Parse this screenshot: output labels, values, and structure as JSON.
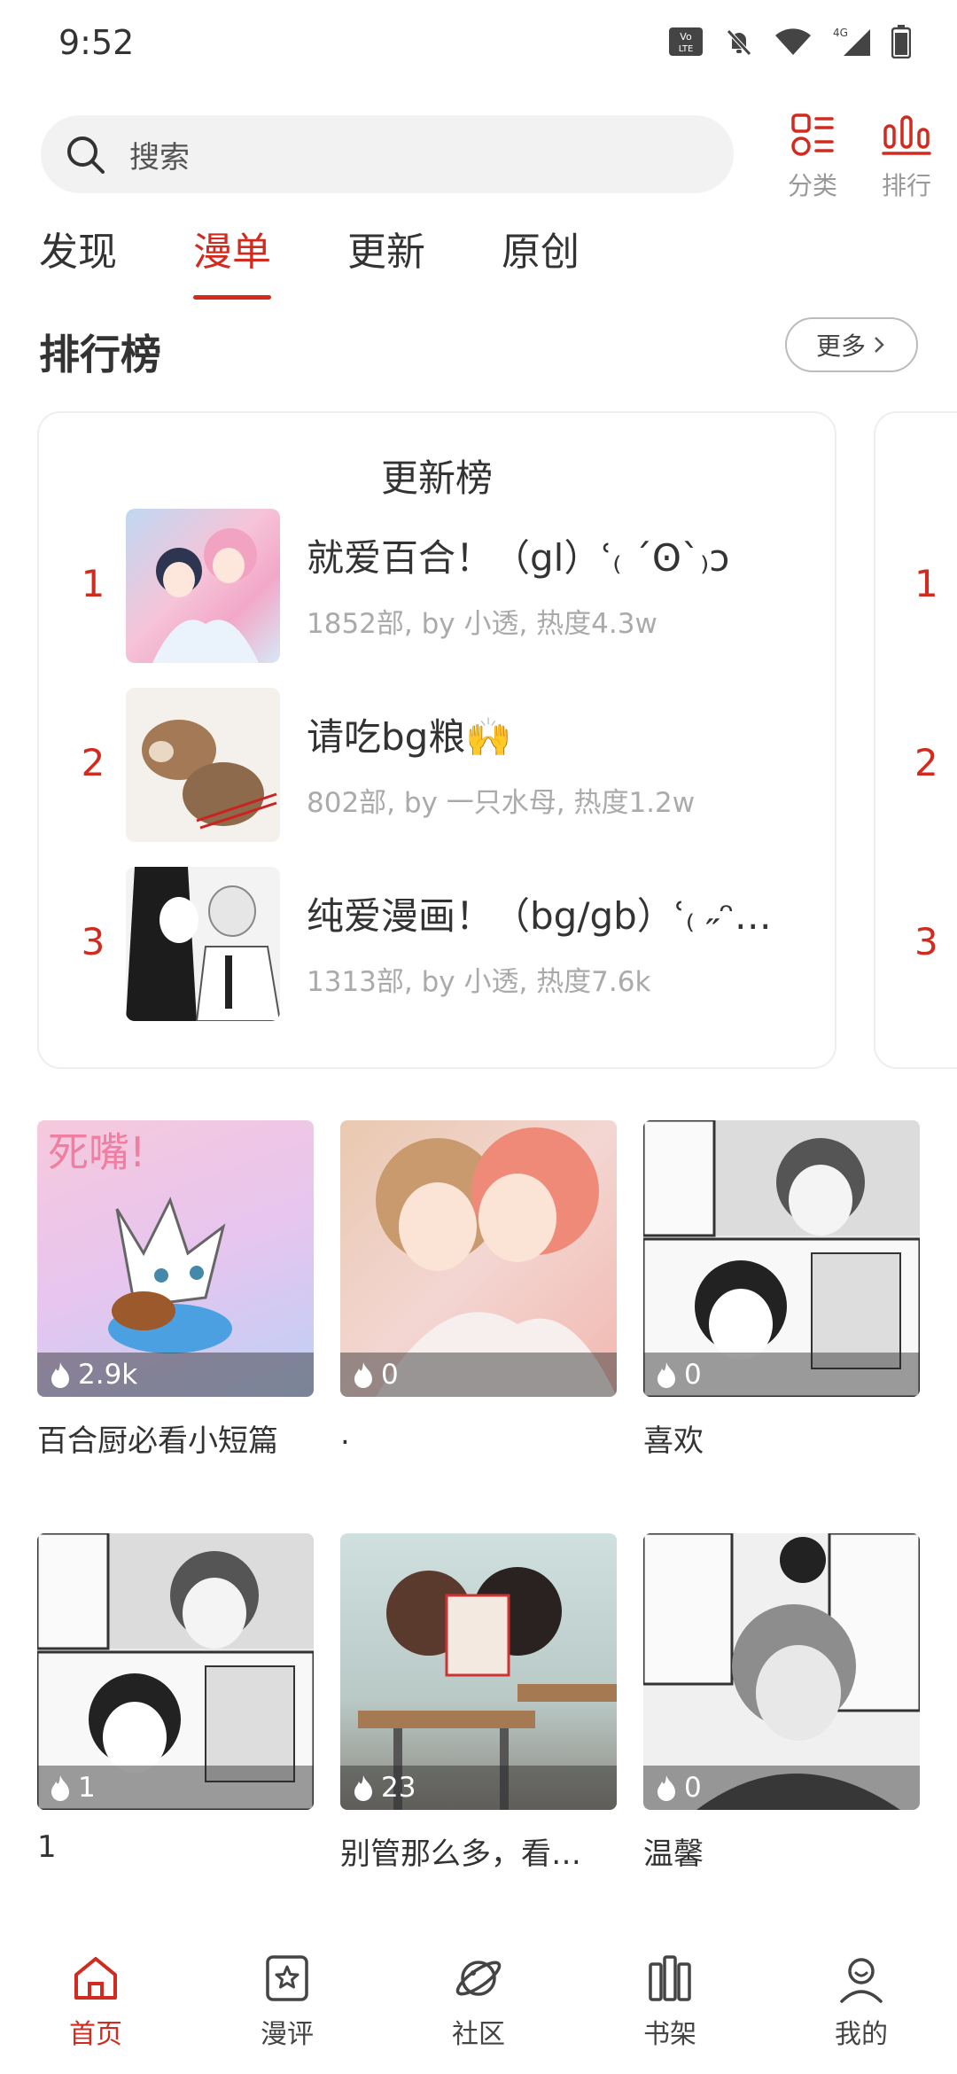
{
  "status_bar": {
    "time": "9:52",
    "network": "4G"
  },
  "search": {
    "placeholder": "搜索"
  },
  "top_actions": {
    "category_label": "分类",
    "ranking_label": "排行"
  },
  "tabs": [
    {
      "label": "发现",
      "active": false
    },
    {
      "label": "漫单",
      "active": true
    },
    {
      "label": "更新",
      "active": false
    },
    {
      "label": "原创",
      "active": false
    }
  ],
  "ranking_section": {
    "title": "排行榜",
    "more_label": "更多",
    "card_title": "更新榜",
    "items": [
      {
        "rank": "1",
        "name": "就爱百合！（gl）ʿ₍ ´Ꙩ`₎ᴐ",
        "meta": "1852部, by 小透, 热度4.3w"
      },
      {
        "rank": "2",
        "name": "请吃bg粮🙌",
        "meta": "802部, by 一只水母, 热度1.2w"
      },
      {
        "rank": "3",
        "name": "纯爱漫画！（bg/gb）ʿ₍ ˶ᵔ…",
        "meta": "1313部, by 小透, 热度7.6k"
      }
    ],
    "peek_ranks": [
      "1",
      "2",
      "3"
    ]
  },
  "lists": [
    {
      "title": "百合厨必看小短篇",
      "heat": "2.9k"
    },
    {
      "title": ".",
      "heat": "0"
    },
    {
      "title": "喜欢",
      "heat": "0"
    },
    {
      "title": "1",
      "heat": "1"
    },
    {
      "title": "别管那么多，看…",
      "heat": "23"
    },
    {
      "title": "温馨",
      "heat": "0"
    }
  ],
  "bottom_nav": [
    {
      "label": "首页",
      "icon": "home-icon",
      "active": true
    },
    {
      "label": "漫评",
      "icon": "star-review-icon",
      "active": false
    },
    {
      "label": "社区",
      "icon": "planet-icon",
      "active": false
    },
    {
      "label": "书架",
      "icon": "bookshelf-icon",
      "active": false
    },
    {
      "label": "我的",
      "icon": "profile-icon",
      "active": false
    }
  ],
  "colors": {
    "accent": "#d12a1f",
    "text": "#333333",
    "muted": "#aaaaaa"
  }
}
